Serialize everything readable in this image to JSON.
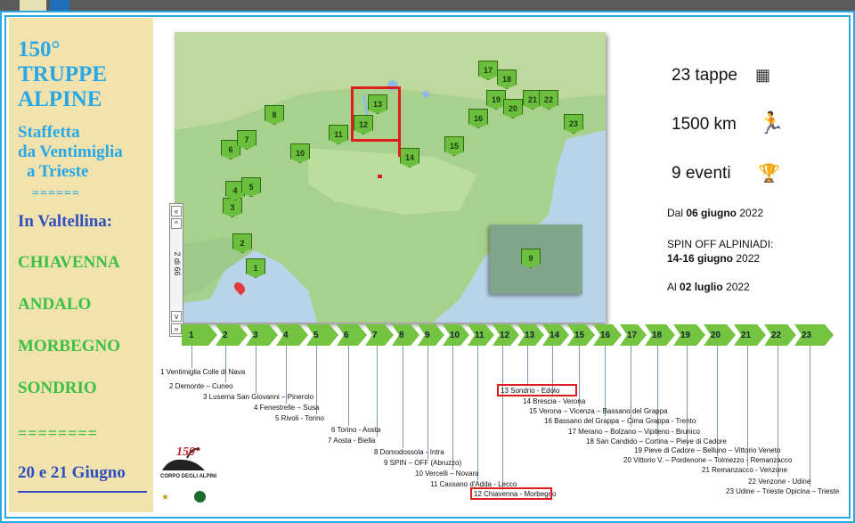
{
  "left_panel": {
    "title_lines": [
      "150°",
      "TRUPPE",
      "ALPINE"
    ],
    "subtitle_lines": [
      "Staffetta",
      "da Ventimiglia",
      "a Trieste"
    ],
    "separator1": "======",
    "valtellina_label": "In Valtellina:",
    "cities": [
      "CHIAVENNA",
      "ANDALO",
      "MORBEGNO",
      "SONDRIO"
    ],
    "separator2": "========",
    "date_label": "20 e 21 Giugno"
  },
  "map": {
    "pins": [
      "1",
      "2",
      "3",
      "4",
      "5",
      "6",
      "7",
      "8",
      "10",
      "11",
      "12",
      "13",
      "14",
      "15",
      "16",
      "17",
      "18",
      "19",
      "20",
      "21",
      "22",
      "23"
    ],
    "inset_pin": "9"
  },
  "scroller": {
    "page_indicator": "2 di 66",
    "up_icon": "double-chevron-up-icon",
    "down_icon": "double-chevron-down-icon",
    "prev_icon": "chevron-down-icon"
  },
  "stats": {
    "tappe": "23 tappe",
    "km": "1500 km",
    "eventi": "9 eventi"
  },
  "notes": {
    "dal_prefix": "Dal ",
    "dal_date": "06 giugno",
    "dal_year": " 2022",
    "spin_line": "SPIN OFF ALPINIADI:",
    "spin_date": "14-16 giugno",
    "spin_year": " 2022",
    "al_prefix": "Al ",
    "al_date": "02 luglio",
    "al_year": " 2022"
  },
  "timeline": {
    "stages": [
      "1",
      "2",
      "3",
      "4",
      "5",
      "6",
      "7",
      "8",
      "9",
      "10",
      "11",
      "12",
      "13",
      "14",
      "15",
      "16",
      "17",
      "18",
      "19",
      "20",
      "21",
      "22",
      "23"
    ],
    "labels": [
      "1 Ventimiglia Colle di Nava",
      "2 Demonte – Cuneo",
      "3 Luserna San Giovanni – Pinerolo",
      "4 Fenestrelle – Susa",
      "5 Rivoli - Torino",
      "6 Torino - Aosta",
      "7 Aosta - Biella",
      "8 Domodossola - Intra",
      "9  SPIN – OFF (Abruzzo)",
      "10 Vercelli – Novara",
      "11 Cassano d'Adda - Lecco",
      "12 Chiavenna - Morbegno",
      "13 Sondrio - Edolo",
      "14 Brescia - Verona",
      "15 Verona – Vicenza – Bassano del Grappa",
      "16 Bassano del Grappa – Cima Grappa - Trento",
      "17 Merano – Bolzano – Vipiteno - Brunico",
      "18 San Candido – Cortina – Pieve di Cadore",
      "19 Pieve di Cadore – Belluno – Vittorio Veneto",
      "20 Vittorio V. – Pordenone – Tolmezzo - Remanzacco",
      "21 Remanzacco - Venzone",
      "22 Venzone - Udine",
      "23 Udine – Trieste Opicina – Trieste"
    ]
  },
  "logo": {
    "number": "150°",
    "caption": "CORPO DEGLI ALPINI"
  },
  "colors": {
    "accent_blue": "#2aa8e6",
    "stage_green": "#74c442",
    "highlight_red": "#e21b1b"
  }
}
